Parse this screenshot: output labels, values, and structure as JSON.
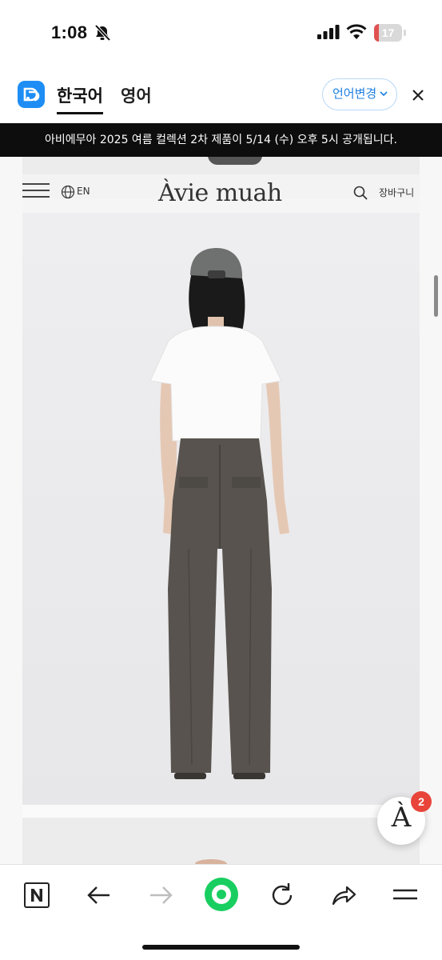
{
  "status_bar": {
    "time": "1:08",
    "battery_level": "17",
    "battery_fraction": 0.17,
    "icons": [
      "bell-slash-icon",
      "cellular-signal-icon",
      "wifi-icon",
      "battery-icon"
    ]
  },
  "translate_bar": {
    "logo_icon": "papago-translate-icon",
    "source_language": "한국어",
    "target_language": "영어",
    "change_language_label": "언어변경",
    "close_icon": "close-icon"
  },
  "announcement": {
    "text": "아비에무아 2025 여름 컬렉션 2차 제품이 5/14 (수) 오후 5시 공개됩니다."
  },
  "site_header": {
    "menu_icon": "hamburger-menu-icon",
    "language_icon": "globe-icon",
    "language_label": "EN",
    "brand_name": "Àvie muah",
    "search_icon": "search-icon",
    "cart_label": "장바구니"
  },
  "floating_button": {
    "letter": "À",
    "badge_count": "2"
  },
  "bottom_toolbar": {
    "items": [
      "naver-n-icon",
      "back-arrow-icon",
      "forward-arrow-icon",
      "green-home-icon",
      "refresh-icon",
      "share-icon",
      "menu-icon"
    ]
  },
  "colors": {
    "accent_blue": "#1e8ef5",
    "announcement_bg": "#0d0d0d",
    "badge_red": "#e8443a",
    "battery_red": "#e05151",
    "naver_green": "#19ce60"
  }
}
